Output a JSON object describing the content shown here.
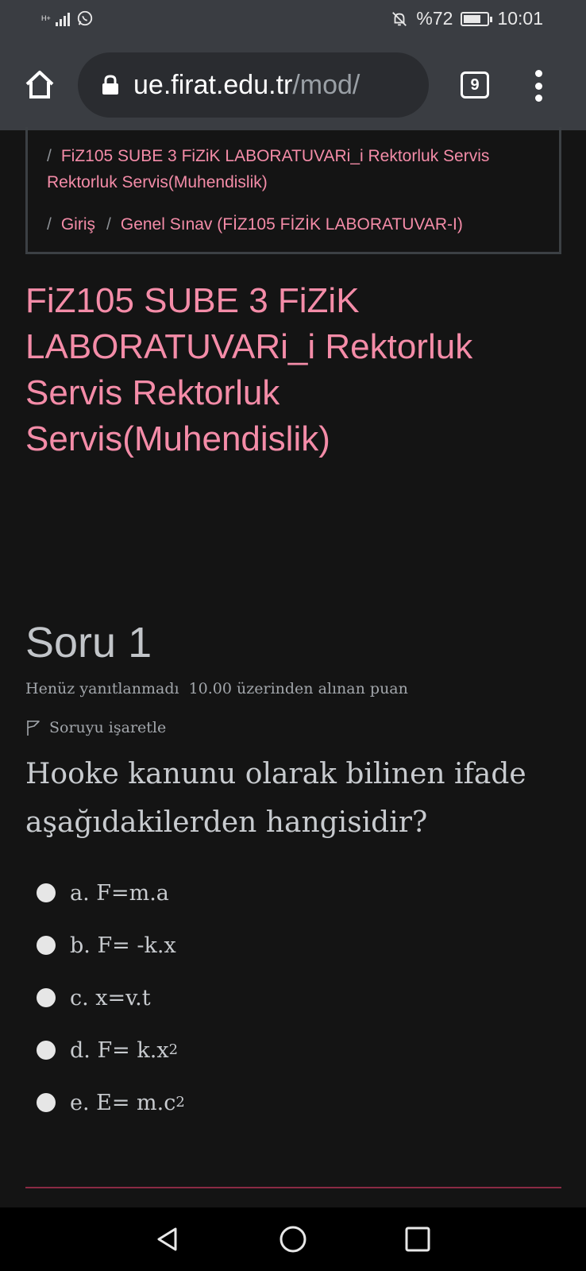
{
  "status_bar": {
    "network": "H+",
    "battery_text": "%72",
    "battery_level": 0.72,
    "time": "10:01"
  },
  "browser": {
    "url_host": "ue.firat.edu.tr",
    "url_path": "/mod/",
    "tab_count": "9"
  },
  "breadcrumb": {
    "separator": "/",
    "course": "FiZ105 SUBE 3 FiZiK LABORATUVARi_i Rektorluk Servis Rektorluk Servis(Muhendislik)",
    "login": "Giriş",
    "exam": "Genel Sınav (FİZ105 FİZİK LABORATUVAR-I)"
  },
  "page_title": "FiZ105 SUBE 3 FiZiK LABORATUVARi_i Rektorluk Servis Rektorluk Servis(Muhendislik)",
  "question": {
    "number": "Soru 1",
    "state": "Henüz yanıtlanmadı",
    "grade": "10.00 üzerinden alınan puan",
    "flag_label": "Soruyu işaretle",
    "text": "Hooke kanunu olarak bilinen ifade aşağıdakilerden hangisidir?",
    "answers": [
      {
        "text": "a. F=m.a",
        "sup": ""
      },
      {
        "text": "b. F= -k.x",
        "sup": ""
      },
      {
        "text": "c. x=v.t",
        "sup": ""
      },
      {
        "text": "d. F= k.x",
        "sup": "2"
      },
      {
        "text": "e. E= m.c",
        "sup": "2"
      }
    ]
  },
  "colors": {
    "accent": "#f48ca8",
    "background": "#141414",
    "bar": "#3a3d42",
    "divider": "#8a2a44"
  }
}
